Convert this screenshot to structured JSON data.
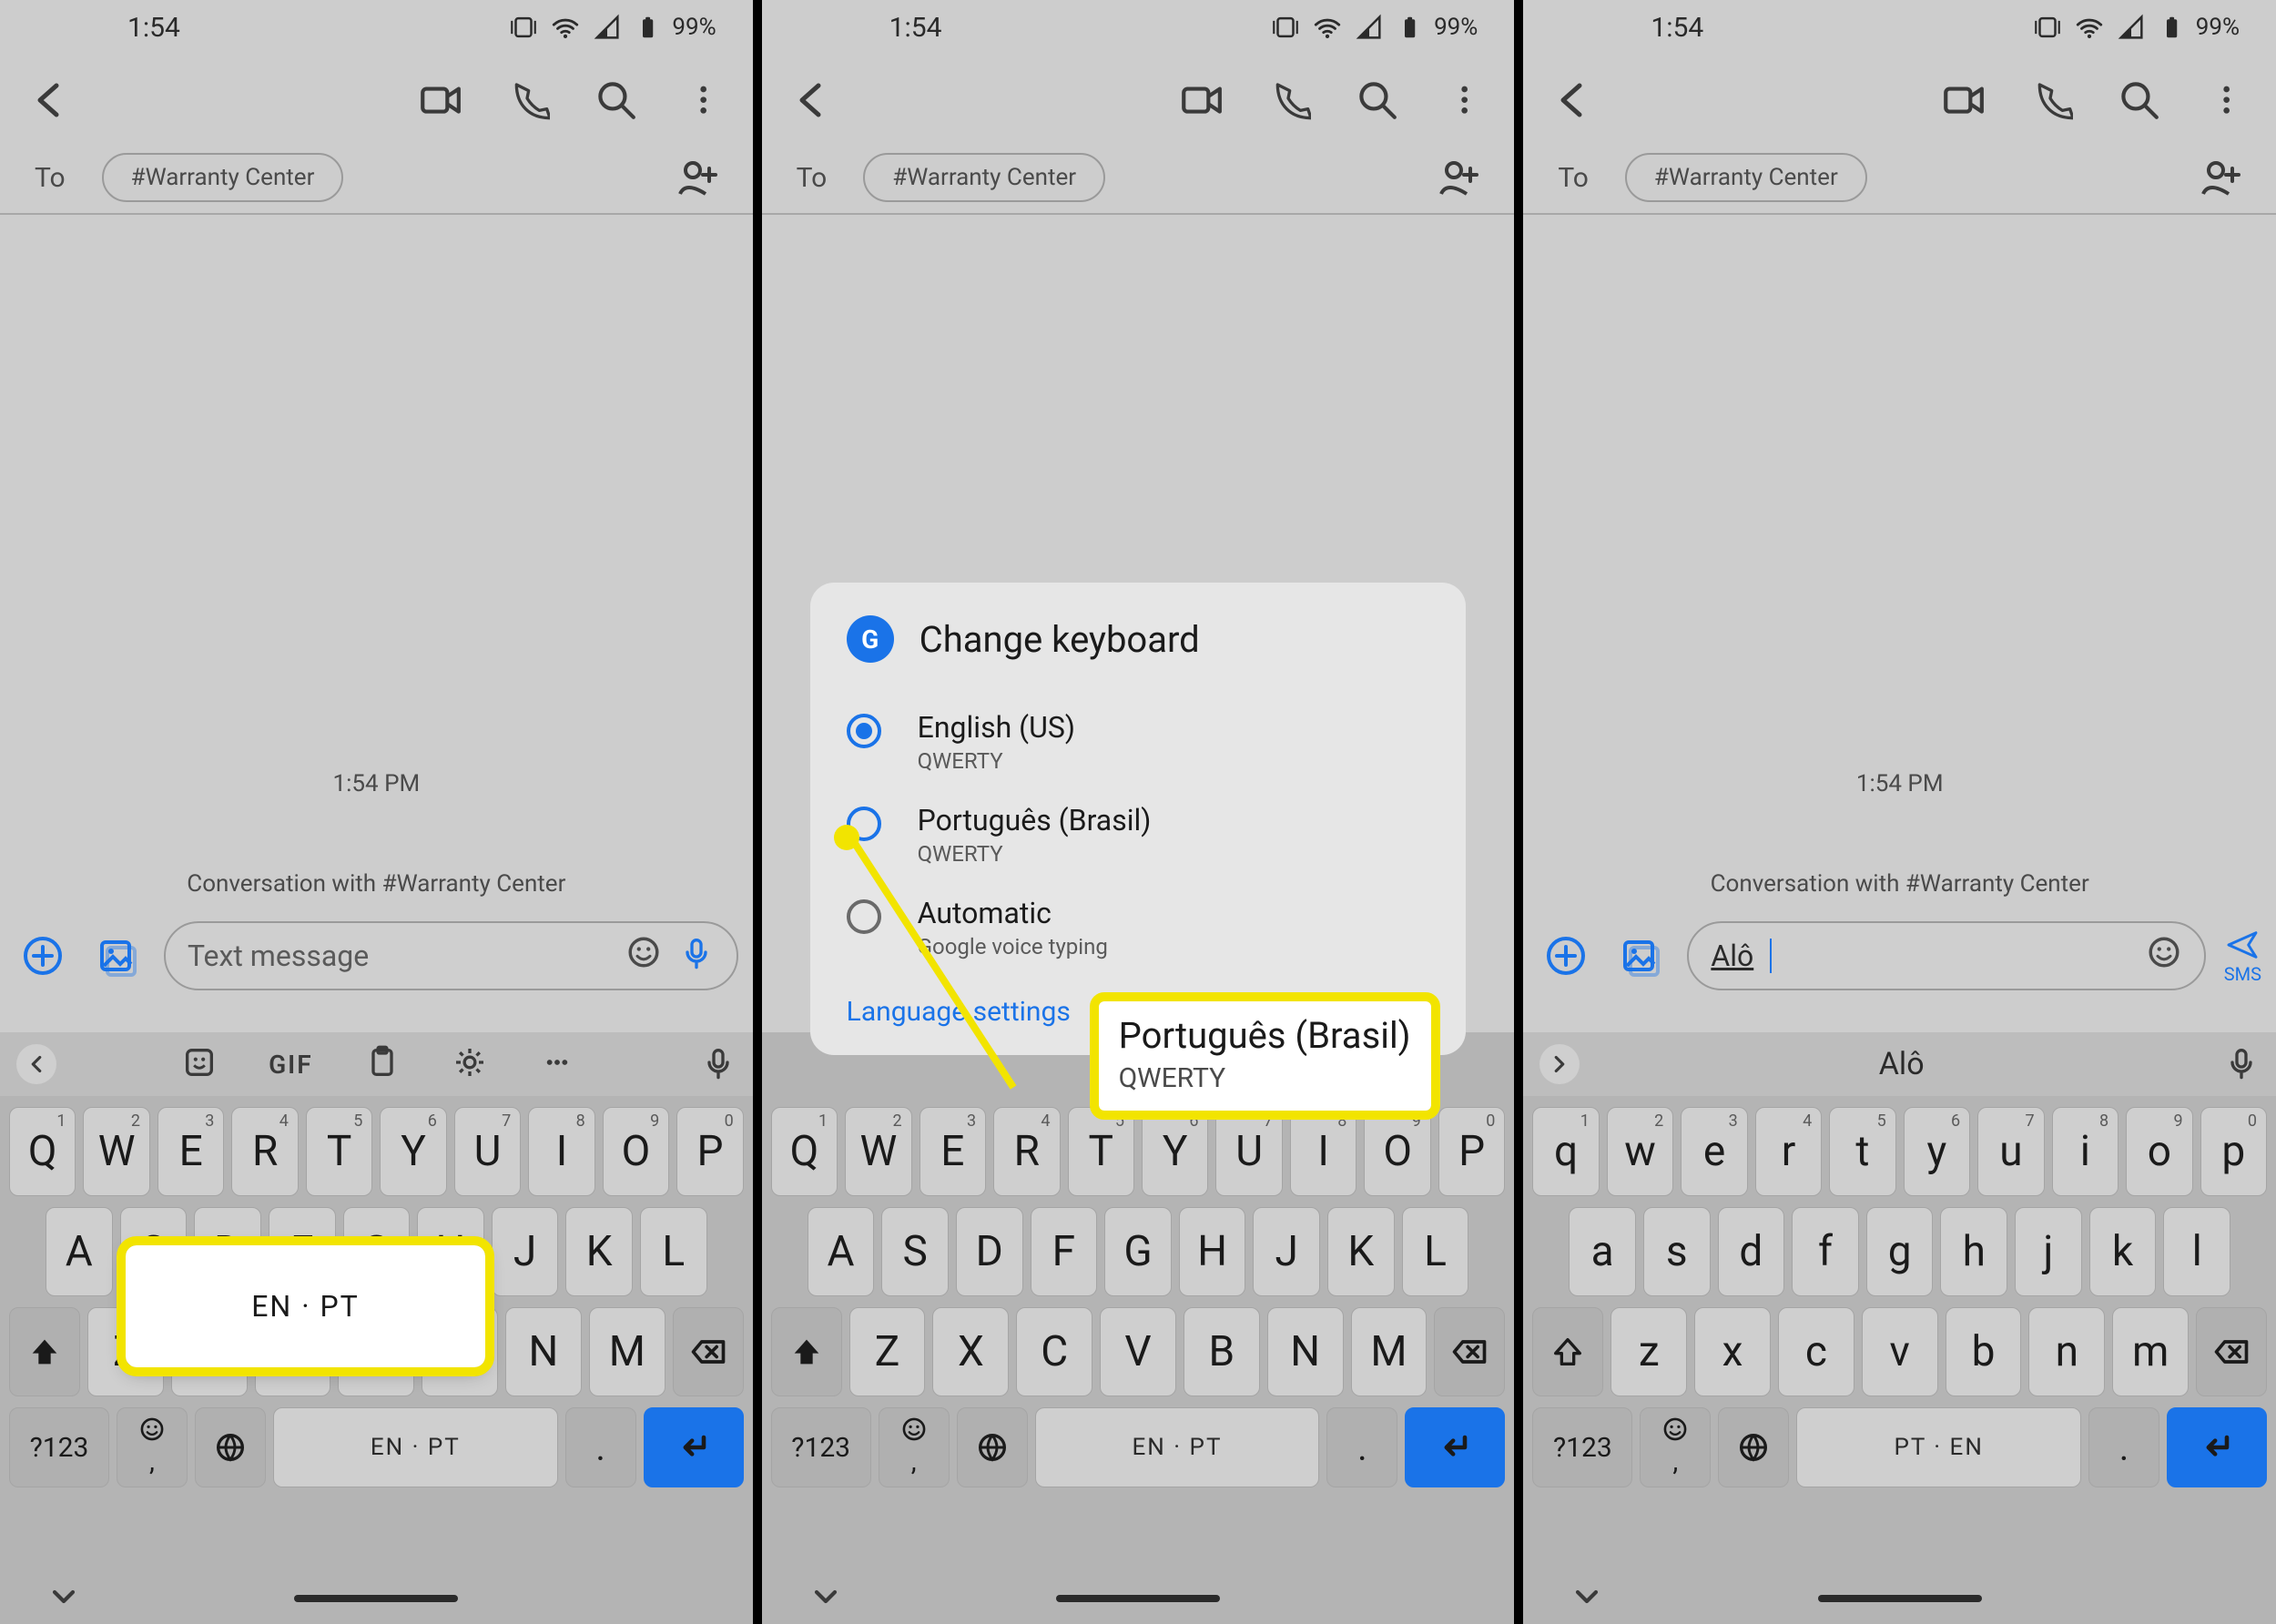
{
  "status": {
    "time": "1:54",
    "battery": "99%"
  },
  "appbar": {
    "to_label": "To",
    "chip": "#Warranty Center"
  },
  "conv": {
    "time": "1:54 PM",
    "with": "Conversation with #Warranty Center",
    "placeholder": "Text message",
    "typed": "Alô"
  },
  "tooltip1": "EN · PT",
  "dialog": {
    "title": "Change keyboard",
    "opts": [
      {
        "t1": "English (US)",
        "t2": "QWERTY"
      },
      {
        "t1": "Português (Brasil)",
        "t2": "QWERTY"
      },
      {
        "t1": "Automatic",
        "t2": "Google voice typing"
      }
    ],
    "link": "Language settings"
  },
  "callout": {
    "c1": "Português (Brasil)",
    "c2": "QWERTY"
  },
  "kb": {
    "gif": "GIF",
    "row1": [
      "Q",
      "W",
      "E",
      "R",
      "T",
      "Y",
      "U",
      "I",
      "O",
      "P"
    ],
    "row1_lc": [
      "q",
      "w",
      "e",
      "r",
      "t",
      "y",
      "u",
      "i",
      "o",
      "p"
    ],
    "sup": [
      "1",
      "2",
      "3",
      "4",
      "5",
      "6",
      "7",
      "8",
      "9",
      "0"
    ],
    "row2": [
      "A",
      "S",
      "D",
      "F",
      "G",
      "H",
      "J",
      "K",
      "L"
    ],
    "row2_lc": [
      "a",
      "s",
      "d",
      "f",
      "g",
      "h",
      "j",
      "k",
      "l"
    ],
    "row3": [
      "Z",
      "X",
      "C",
      "V",
      "B",
      "N",
      "M"
    ],
    "row3_lc": [
      "z",
      "x",
      "c",
      "v",
      "b",
      "n",
      "m"
    ],
    "sym": "?123",
    "space_en": "EN · PT",
    "space_pt": "PT · EN",
    "period": ".",
    "sugg3": "Alô",
    "sms": "SMS"
  }
}
